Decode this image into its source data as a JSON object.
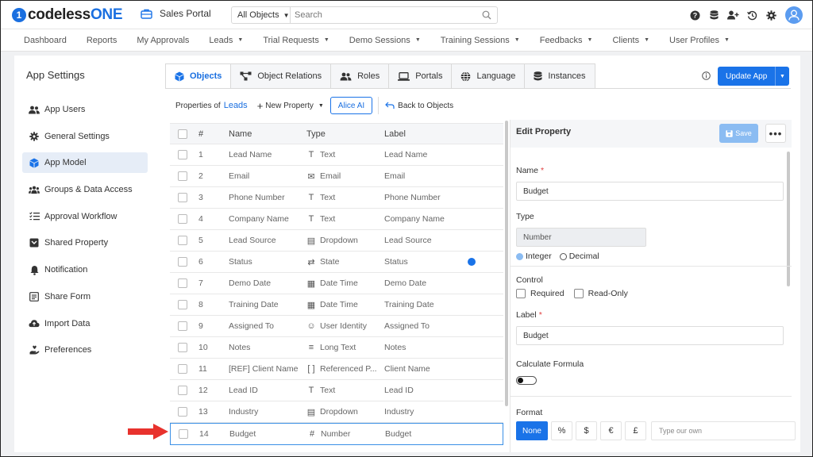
{
  "app": {
    "logo_prefix": "codeless",
    "logo_suffix": "ONE",
    "portal_name": "Sales Portal"
  },
  "search": {
    "scope": "All Objects",
    "placeholder": "Search"
  },
  "top_icons": [
    "help-icon",
    "database-icon",
    "add-user-icon",
    "history-icon",
    "settings-icon",
    "avatar"
  ],
  "nav": {
    "items": [
      {
        "label": "Dashboard",
        "dropdown": false
      },
      {
        "label": "Reports",
        "dropdown": false
      },
      {
        "label": "My Approvals",
        "dropdown": false
      },
      {
        "label": "Leads",
        "dropdown": true
      },
      {
        "label": "Trial Requests",
        "dropdown": true
      },
      {
        "label": "Demo Sessions",
        "dropdown": true
      },
      {
        "label": "Training Sessions",
        "dropdown": true
      },
      {
        "label": "Feedbacks",
        "dropdown": true
      },
      {
        "label": "Clients",
        "dropdown": true
      },
      {
        "label": "User Profiles",
        "dropdown": true
      }
    ]
  },
  "sidebar": {
    "title": "App Settings",
    "items": [
      {
        "label": "App Users",
        "icon": "users-icon"
      },
      {
        "label": "General Settings",
        "icon": "gear-icon"
      },
      {
        "label": "App Model",
        "icon": "cube-icon",
        "active": true
      },
      {
        "label": "Groups & Data Access",
        "icon": "groups-icon"
      },
      {
        "label": "Approval Workflow",
        "icon": "checklist-icon"
      },
      {
        "label": "Shared Property",
        "icon": "shared-icon"
      },
      {
        "label": "Notification",
        "icon": "bell-icon"
      },
      {
        "label": "Share Form",
        "icon": "form-icon"
      },
      {
        "label": "Import Data",
        "icon": "cloud-upload-icon"
      },
      {
        "label": "Preferences",
        "icon": "preferences-icon"
      }
    ]
  },
  "tabs": [
    {
      "label": "Objects",
      "active": true
    },
    {
      "label": "Object Relations"
    },
    {
      "label": "Roles"
    },
    {
      "label": "Portals"
    },
    {
      "label": "Language"
    },
    {
      "label": "Instances"
    }
  ],
  "toolbar": {
    "update_label": "Update App",
    "properties_of": "Properties of",
    "object_name": "Leads",
    "new_property": "New Property",
    "alice": "Alice AI",
    "back": "Back to Objects"
  },
  "table": {
    "headers": {
      "num": "#",
      "name": "Name",
      "type": "Type",
      "label": "Label"
    },
    "rows": [
      {
        "num": "1",
        "name": "Lead Name",
        "type": "Text",
        "icon": "T",
        "label": "Lead Name"
      },
      {
        "num": "2",
        "name": "Email",
        "type": "Email",
        "icon": "✉",
        "label": "Email"
      },
      {
        "num": "3",
        "name": "Phone Number",
        "type": "Text",
        "icon": "T",
        "label": "Phone Number"
      },
      {
        "num": "4",
        "name": "Company Name",
        "type": "Text",
        "icon": "T",
        "label": "Company Name"
      },
      {
        "num": "5",
        "name": "Lead Source",
        "type": "Dropdown",
        "icon": "▤",
        "label": "Lead Source"
      },
      {
        "num": "6",
        "name": "Status",
        "type": "State",
        "icon": "⇄",
        "label": "Status",
        "dot": true
      },
      {
        "num": "7",
        "name": "Demo Date",
        "type": "Date Time",
        "icon": "▦",
        "label": "Demo Date"
      },
      {
        "num": "8",
        "name": "Training Date",
        "type": "Date Time",
        "icon": "▦",
        "label": "Training Date"
      },
      {
        "num": "9",
        "name": "Assigned To",
        "type": "User Identity",
        "icon": "☺",
        "label": "Assigned To"
      },
      {
        "num": "10",
        "name": "Notes",
        "type": "Long Text",
        "icon": "≡",
        "label": "Notes"
      },
      {
        "num": "11",
        "name": "[REF] Client Name",
        "type": "Referenced P...",
        "icon": "[ ]",
        "label": "Client Name"
      },
      {
        "num": "12",
        "name": "Lead ID",
        "type": "Text",
        "icon": "T",
        "label": "Lead ID"
      },
      {
        "num": "13",
        "name": "Industry",
        "type": "Dropdown",
        "icon": "▤",
        "label": "Industry"
      },
      {
        "num": "14",
        "name": "Budget",
        "type": "Number",
        "icon": "#",
        "label": "Budget",
        "selected": true
      }
    ]
  },
  "edit": {
    "title": "Edit Property",
    "save": "Save",
    "name_label": "Name",
    "name_value": "Budget",
    "type_label": "Type",
    "type_value": "Number",
    "integer": "Integer",
    "decimal": "Decimal",
    "control_label": "Control",
    "required": "Required",
    "readonly": "Read-Only",
    "label_label": "Label",
    "label_value": "Budget",
    "formula_label": "Calculate Formula",
    "format_label": "Format",
    "format_none": "None",
    "format_percent": "%",
    "format_dollar": "$",
    "format_euro": "€",
    "format_pound": "£",
    "format_placeholder": "Type our own"
  },
  "colors": {
    "accent": "#1a73e8",
    "arrow": "#e8322d"
  }
}
